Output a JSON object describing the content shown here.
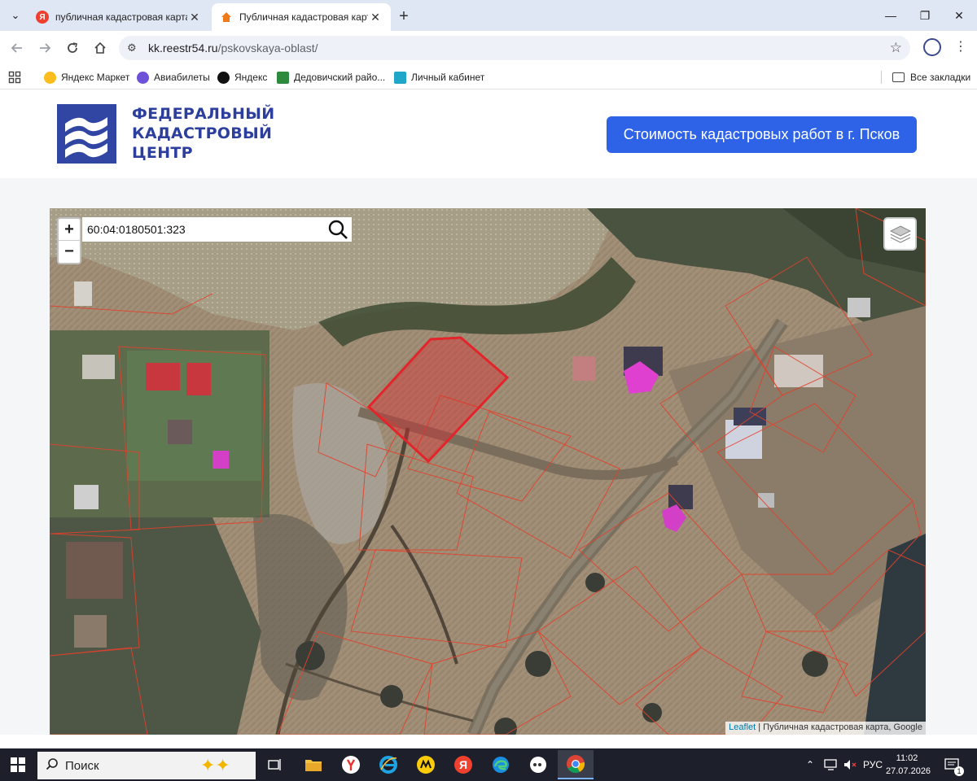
{
  "browser": {
    "tabs": [
      {
        "title": "публичная кадастровая карта",
        "active": false
      },
      {
        "title": "Публичная кадастровая карта",
        "active": true
      }
    ],
    "url_domain": "kk.reestr54.ru",
    "url_path": "/pskovskaya-oblast/",
    "bookmarks": [
      {
        "label": "Яндекс Маркет"
      },
      {
        "label": "Авиабилеты"
      },
      {
        "label": "Яндекс"
      },
      {
        "label": "Дедовичский райо..."
      },
      {
        "label": "Личный кабинет"
      }
    ],
    "all_bookmarks_label": "Все закладки"
  },
  "site": {
    "logo_line1": "ФЕДЕРАЛЬНЫЙ",
    "logo_line2": "КАДАСТРОВЫЙ",
    "logo_line3": "ЦЕНТР",
    "cta_label": "Стоимость кадастровых работ в г. Псков"
  },
  "map": {
    "zoom_in": "+",
    "zoom_out": "−",
    "search_value": "60:04:0180501:323",
    "attribution_link": "Leaflet",
    "attribution_text": " | Публичная кадастровая карта, Google"
  },
  "taskbar": {
    "search_placeholder": "Поиск",
    "language": "РУС",
    "time": "11:02",
    "date": "27.07.2026",
    "notification_count": "1"
  },
  "colors": {
    "brand_blue": "#2d3f9c",
    "cta_blue": "#2e63e8",
    "parcel_red": "#e3242b",
    "building_magenta": "#e040d0"
  }
}
